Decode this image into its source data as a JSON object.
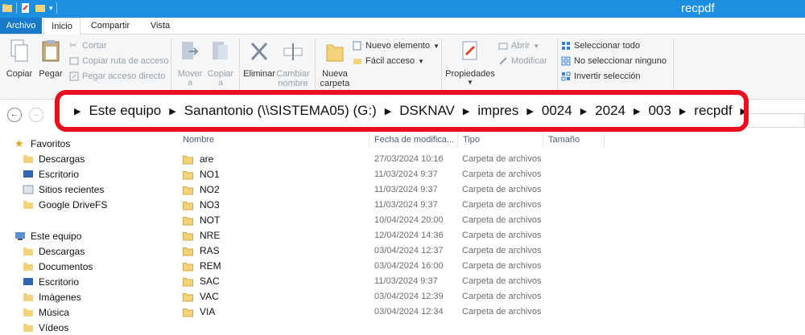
{
  "window": {
    "title": "recpdf"
  },
  "ribbon_tabs": {
    "file": "Archivo",
    "home": "Inicio",
    "share": "Compartir",
    "view": "Vista"
  },
  "ribbon": {
    "copy": "Copiar",
    "paste": "Pegar",
    "cut": "Cortar",
    "copy_path": "Copiar ruta de acceso",
    "paste_shortcut": "Pegar acceso directo",
    "move_to": [
      "Mover",
      "a"
    ],
    "copy_to": [
      "Copiar",
      "a"
    ],
    "delete": "Eliminar",
    "rename": [
      "Cambiar",
      "nombre"
    ],
    "new_folder": [
      "Nueva",
      "carpeta"
    ],
    "new_item": "Nuevo elemento",
    "easy_access": "Fácil acceso",
    "properties": "Propiedades",
    "open": "Abrir",
    "edit": "Modificar",
    "select_all": "Seleccionar todo",
    "select_none": "No seleccionar ninguno",
    "invert_selection": "Invertir selección"
  },
  "address": {
    "segments": [
      "Este equipo",
      "Sanantonio (\\\\SISTEMA05) (G:)",
      "DSKNAV",
      "impres",
      "0024",
      "2024",
      "003",
      "recpdf"
    ],
    "highlight_color": "#e8101e"
  },
  "nav_pane": {
    "favorites": "Favoritos",
    "fav_items": [
      "Descargas",
      "Escritorio",
      "Sitios recientes",
      "Google DriveFS"
    ],
    "this_pc": "Este equipo",
    "pc_items": [
      "Descargas",
      "Documentos",
      "Escritorio",
      "Imágenes",
      "Música",
      "Vídeos"
    ]
  },
  "columns": {
    "name": "Nombre",
    "date": "Fecha de modifica...",
    "type": "Tipo",
    "size": "Tamaño"
  },
  "files": [
    {
      "name": "are",
      "date": "27/03/2024 10:16",
      "type": "Carpeta de archivos"
    },
    {
      "name": "NO1",
      "date": "11/03/2024 9:37",
      "type": "Carpeta de archivos"
    },
    {
      "name": "NO2",
      "date": "11/03/2024 9:37",
      "type": "Carpeta de archivos"
    },
    {
      "name": "NO3",
      "date": "11/03/2024 9:37",
      "type": "Carpeta de archivos"
    },
    {
      "name": "NOT",
      "date": "10/04/2024 20:00",
      "type": "Carpeta de archivos"
    },
    {
      "name": "NRE",
      "date": "12/04/2024 14:36",
      "type": "Carpeta de archivos"
    },
    {
      "name": "RAS",
      "date": "03/04/2024 12:37",
      "type": "Carpeta de archivos"
    },
    {
      "name": "REM",
      "date": "03/04/2024 16:00",
      "type": "Carpeta de archivos"
    },
    {
      "name": "SAC",
      "date": "11/03/2024 9:37",
      "type": "Carpeta de archivos"
    },
    {
      "name": "VAC",
      "date": "03/04/2024 12:39",
      "type": "Carpeta de archivos"
    },
    {
      "name": "VIA",
      "date": "03/04/2024 12:34",
      "type": "Carpeta de archivos"
    }
  ],
  "colors": {
    "title_bar": "#1e8fe0",
    "file_tab": "#1979ca",
    "folder": "#e8c25a"
  }
}
